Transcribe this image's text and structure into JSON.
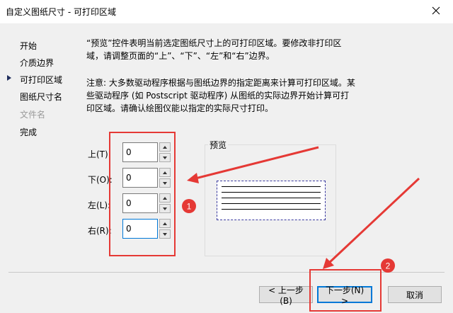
{
  "window": {
    "title": "自定义图纸尺寸 - 可打印区域"
  },
  "nav": {
    "items": [
      {
        "label": "开始"
      },
      {
        "label": "介质边界"
      },
      {
        "label": "可打印区域"
      },
      {
        "label": "图纸尺寸名"
      },
      {
        "label": "文件名"
      },
      {
        "label": "完成"
      }
    ],
    "current": "可打印区域"
  },
  "main": {
    "description": "“预览”控件表明当前选定图纸尺寸上的可打印区域。要修改非打印区域，请调整页面的“上”、“下”、“左”和“右”边界。",
    "note": "注意: 大多数驱动程序根据与图纸边界的指定距离来计算可打印区域。某些驱动程序 (如 Postscript 驱动程序) 从图纸的实际边界开始计算可打印区域。请确认绘图仪能以指定的实际尺寸打印。",
    "fields": {
      "top": {
        "label": "上(T):",
        "value": "0"
      },
      "bottom": {
        "label": "下(O):",
        "value": "0"
      },
      "left": {
        "label": "左(L):",
        "value": "0"
      },
      "right": {
        "label": "右(R):",
        "value": "0"
      }
    },
    "preview_label": "预览"
  },
  "buttons": {
    "back": "< 上一步(B)",
    "next": "下一步(N) >",
    "cancel": "取消"
  },
  "annotations": {
    "marker_1": "1",
    "marker_2": "2"
  },
  "colors": {
    "annotation_red": "#e53935",
    "accent": "#0078d7"
  }
}
